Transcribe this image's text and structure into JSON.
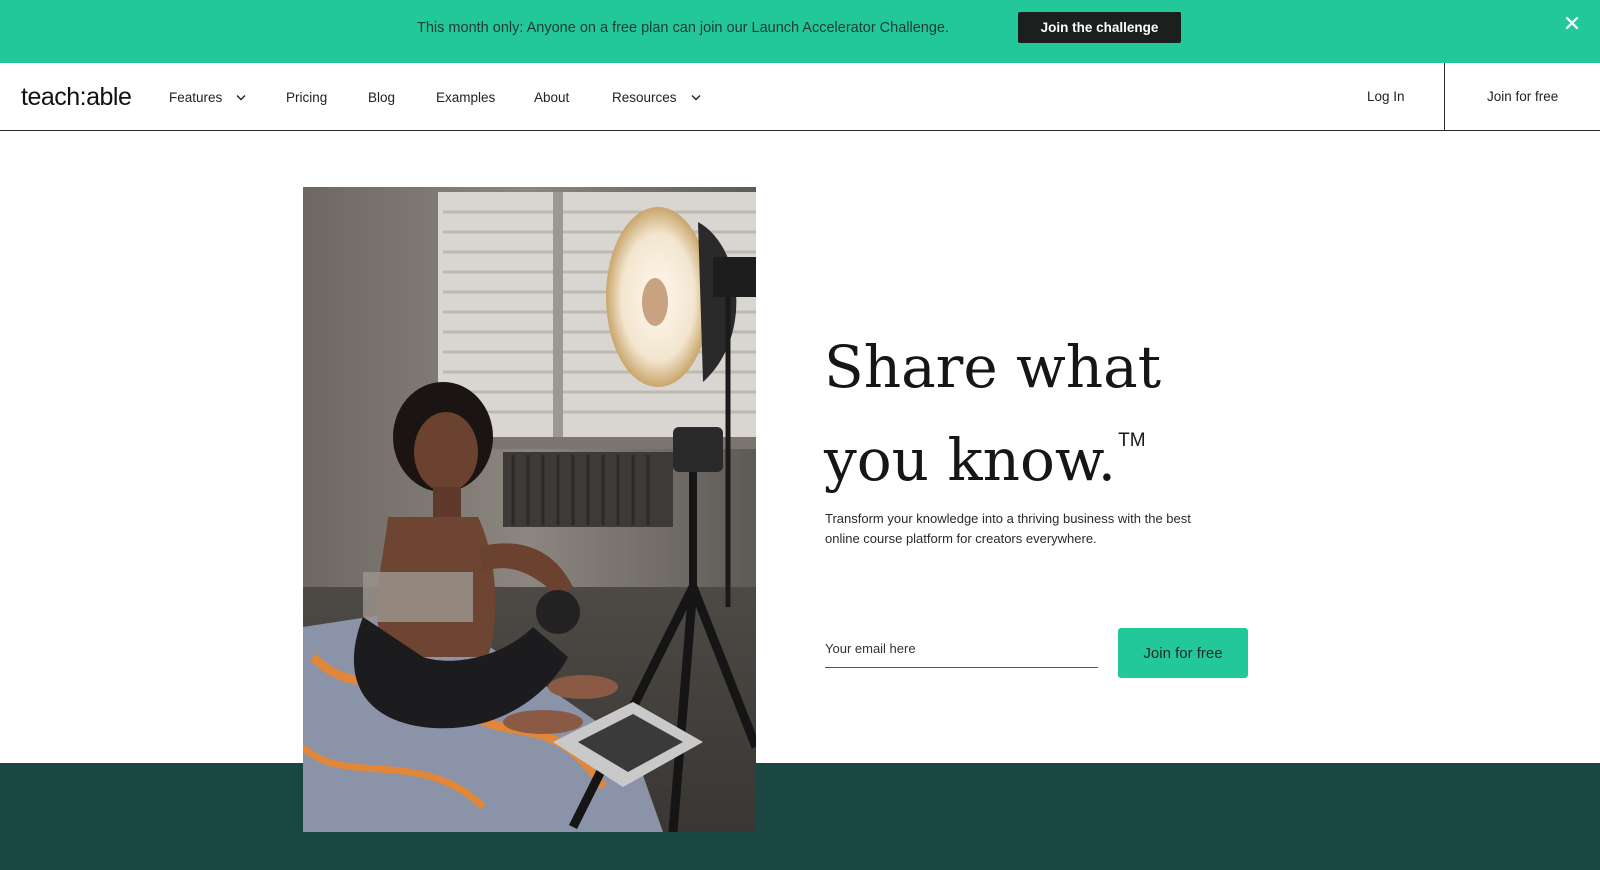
{
  "banner": {
    "text": "This month only: Anyone on a free plan can join our Launch Accelerator Challenge.",
    "button_label": "Join the challenge",
    "close_icon": "close-icon"
  },
  "nav": {
    "logo": "teach:able",
    "items": [
      {
        "label": "Features",
        "has_dropdown": true
      },
      {
        "label": "Pricing",
        "has_dropdown": false
      },
      {
        "label": "Blog",
        "has_dropdown": false
      },
      {
        "label": "Examples",
        "has_dropdown": false
      },
      {
        "label": "About",
        "has_dropdown": false
      },
      {
        "label": "Resources",
        "has_dropdown": true
      }
    ],
    "login_label": "Log In",
    "join_label": "Join for free"
  },
  "hero": {
    "title": "Share what you know.",
    "trademark": "TM",
    "subtitle": "Transform your knowledge into a thriving business with the best online course platform for creators everywhere.",
    "email_placeholder": "Your email here",
    "cta_label": "Join for free"
  },
  "colors": {
    "accent": "#22c89a",
    "dark_band": "#1a4744",
    "dark_button": "#1b1f1e"
  }
}
